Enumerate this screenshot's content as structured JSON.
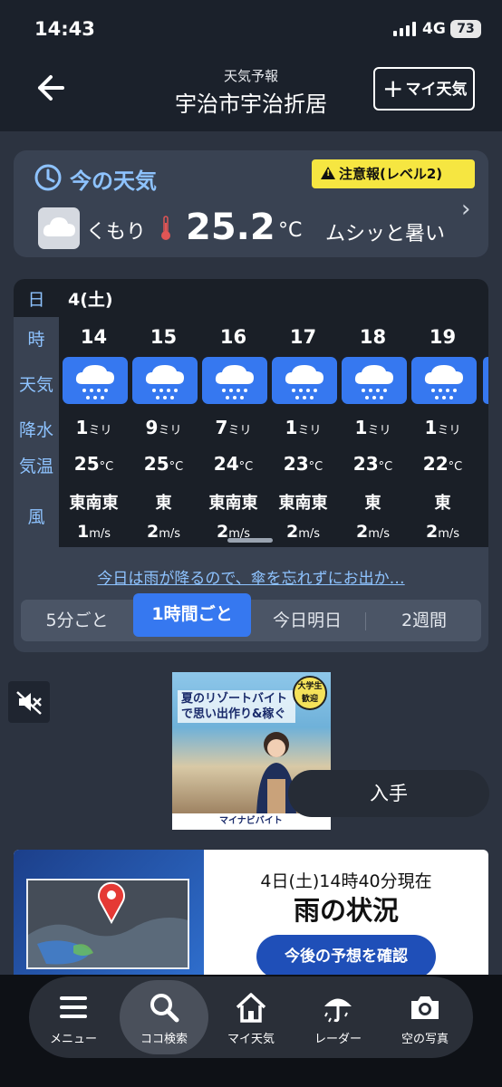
{
  "status_bar": {
    "time": "14:43",
    "network": "4G",
    "battery": "73"
  },
  "header": {
    "subtitle": "天気予報",
    "title": "宇治市宇治折居",
    "my_weather_label": "マイ天気"
  },
  "current": {
    "label": "今の天気",
    "warning": "注意報(レベル2)",
    "condition": "くもり",
    "temperature": "25.2",
    "unit": "°C",
    "feel": "ムシッと暑い"
  },
  "hourly": {
    "row_labels": {
      "day": "日",
      "hour": "時",
      "weather": "天気",
      "rain": "降水",
      "temp": "気温",
      "wind": "風"
    },
    "date": "4(土)",
    "rain_unit": "ミリ",
    "temp_unit": "°C",
    "wind_unit": "m/s",
    "hours": [
      {
        "hour": "14",
        "weather": "rain-icon",
        "rain": "1",
        "temp": "25",
        "wind_dir": "東南東",
        "wind_speed": "1"
      },
      {
        "hour": "15",
        "weather": "rain-icon",
        "rain": "9",
        "temp": "25",
        "wind_dir": "東",
        "wind_speed": "2"
      },
      {
        "hour": "16",
        "weather": "rain-icon",
        "rain": "7",
        "temp": "24",
        "wind_dir": "東南東",
        "wind_speed": "2"
      },
      {
        "hour": "17",
        "weather": "rain-icon",
        "rain": "1",
        "temp": "23",
        "wind_dir": "東南東",
        "wind_speed": "2"
      },
      {
        "hour": "18",
        "weather": "rain-icon",
        "rain": "1",
        "temp": "23",
        "wind_dir": "東",
        "wind_speed": "2"
      },
      {
        "hour": "19",
        "weather": "rain-icon",
        "rain": "1",
        "temp": "22",
        "wind_dir": "東",
        "wind_speed": "2"
      }
    ],
    "tip": "今日は雨が降るので、傘を忘れずにお出か…",
    "tabs": [
      "5分ごと",
      "1時間ごと",
      "今日明日",
      "2週間"
    ],
    "active_tab": "1時間ごと"
  },
  "ad": {
    "title": "夏のリゾートバイトで思い出作り&稼ぐ",
    "badge": "大学生歓迎",
    "brand": "マイナビバイト",
    "cta": "入手"
  },
  "rain_banner": {
    "timestamp": "4日(土)14時40分現在",
    "title": "雨の状況",
    "button": "今後の予想を確認"
  },
  "nav": [
    {
      "label": "メニュー",
      "icon": "menu-icon"
    },
    {
      "label": "ココ検索",
      "icon": "search-icon"
    },
    {
      "label": "マイ天気",
      "icon": "home-icon"
    },
    {
      "label": "レーダー",
      "icon": "umbrella-icon"
    },
    {
      "label": "空の写真",
      "icon": "camera-icon"
    }
  ],
  "colors": {
    "accent": "#3678f0",
    "label_blue": "#8ec3ff",
    "warning": "#f6e641"
  }
}
